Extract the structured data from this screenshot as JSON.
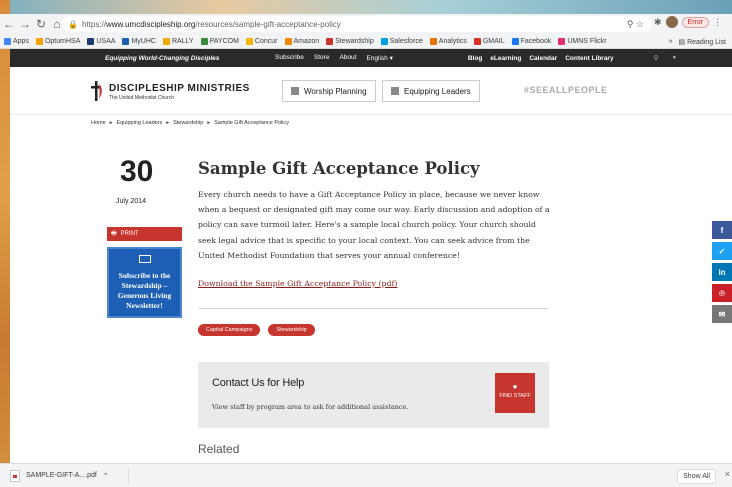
{
  "browser": {
    "url_prefix": "https://",
    "url_host": "www.umcdiscipleship.org",
    "url_path": "/resources/sample-gift-acceptance-policy",
    "error_label": "Error",
    "bookmarks": [
      {
        "label": "Apps",
        "color": "#4285f4"
      },
      {
        "label": "OptumHSA",
        "color": "#f4a300"
      },
      {
        "label": "USAA",
        "color": "#1a3d6d"
      },
      {
        "label": "MyUHC",
        "color": "#1a5fb4"
      },
      {
        "label": "RALLY",
        "color": "#f2a900"
      },
      {
        "label": "PAYCOM",
        "color": "#3b8a3b"
      },
      {
        "label": "Concur",
        "color": "#f4b400"
      },
      {
        "label": "Amazon",
        "color": "#f08a00"
      },
      {
        "label": "Stewardship",
        "color": "#c6362f"
      },
      {
        "label": "Salesforce",
        "color": "#00a1e0"
      },
      {
        "label": "Analytics",
        "color": "#e37400"
      },
      {
        "label": "GMAIL",
        "color": "#d93025"
      },
      {
        "label": "Facebook",
        "color": "#1877f2"
      },
      {
        "label": "UMNS Flickr",
        "color": "#e0306b"
      }
    ],
    "bookmarks_more": "»",
    "reading_list": "Reading List"
  },
  "site": {
    "tagline": "Equipping World-Changing Disciples",
    "topnav": [
      "Subscribe",
      "Store",
      "About",
      "English ▾"
    ],
    "topnav2": [
      "Blog",
      "eLearning",
      "Calendar",
      "Content Library"
    ],
    "logo_title": "DISCIPLESHIP MINISTRIES",
    "logo_sub": "The United Methodist Church",
    "worship_btn": "Worship Planning",
    "leaders_btn": "Equipping Leaders",
    "seeall": "#SEEALLPEOPLE",
    "breadcrumbs": [
      "Home",
      "Equipping Leaders",
      "Stewardship",
      "Sample Gift Acceptance Policy"
    ]
  },
  "article": {
    "day": "30",
    "month_year": "July 2014",
    "print_label": "PRINT",
    "subscribe_text": "Subscribe to the Stewardship – Generous Living Newsletter!",
    "title": "Sample Gift Acceptance Policy",
    "body": "Every church needs to have a Gift Acceptance Policy in place, because we never know when a bequest or designated gift may come our way. Early discussion and adoption of a policy can save turmoil later. Here's a sample local church policy. Your church should seek legal advice that is specific to your local context. You can seek advice from the United Methodist Foundation that serves your annual conference!",
    "download_link": "Download the Sample Gift Acceptance Policy (pdf)",
    "tags": [
      "Capital Campaigns",
      "Stewardship"
    ],
    "contact_heading": "Contact Us for Help",
    "contact_text": "View staff by program area to ask for additional assistance.",
    "find_staff": "FIND STAFF",
    "related": "Related"
  },
  "share": [
    {
      "icon": "f",
      "name": "facebook",
      "color": "#3b5998"
    },
    {
      "icon": "t",
      "name": "twitter",
      "color": "#1da1f2"
    },
    {
      "icon": "in",
      "name": "linkedin",
      "color": "#0077b5"
    },
    {
      "icon": "p",
      "name": "pinterest",
      "color": "#cb2027"
    },
    {
      "icon": "✉",
      "name": "email",
      "color": "#777777"
    }
  ],
  "downloads": {
    "file": "SAMPLE-GIFT-A....pdf",
    "show_all": "Show All"
  }
}
